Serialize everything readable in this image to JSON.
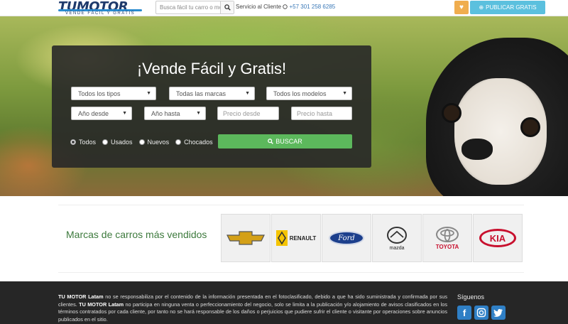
{
  "header": {
    "logo_text": "TUMOTOR",
    "logo_tagline": "VENDE FÁCIL Y GRATIS",
    "search_placeholder": "Busca fácil tu carro o mo",
    "service_label": "Servicio al Cliente",
    "service_phone": "+57 301 258 6285",
    "publish_label": "PUBLICAR GRATIS",
    "icons": {
      "search": "search-icon",
      "whatsapp": "whatsapp-icon",
      "favorite": "heart-icon",
      "publish": "plus-circle-icon"
    }
  },
  "search_panel": {
    "title": "¡Vende Fácil y Gratis!",
    "selects": {
      "type": "Todos los tipos",
      "brand": "Todas las marcas",
      "model": "Todos los modelos",
      "year_from": "Año desde",
      "year_to": "Año hasta"
    },
    "price_from_placeholder": "Precio desde",
    "price_to_placeholder": "Precio hasta",
    "condition_options": [
      "Todos",
      "Usados",
      "Nuevos",
      "Chocados"
    ],
    "selected_condition": "Todos",
    "search_button": "BUSCAR"
  },
  "brands": {
    "title": "Marcas de carros más vendidos",
    "items": [
      {
        "name": "Chevrolet",
        "label": "",
        "color": "#d4a017"
      },
      {
        "name": "Renault",
        "label": "RENAULT",
        "color": "#f5c400"
      },
      {
        "name": "Ford",
        "label": "Ford",
        "color": "#1c3f8c"
      },
      {
        "name": "Mazda",
        "label": "mazda",
        "color": "#1a1a1a"
      },
      {
        "name": "Toyota",
        "label": "TOYOTA",
        "color": "#c8102e"
      },
      {
        "name": "Kia",
        "label": "KIA",
        "color": "#c8102e"
      }
    ]
  },
  "footer": {
    "brand": "TU MOTOR Latam",
    "text_1": "no se responsabiliza por el contenido de la información presentada en el fotoclasificado, debido a que ha sido suministrada y confirmada por sus clientes.",
    "text_2": "no participa en ninguna venta o perfeccionamiento del negocio, solo se limita a la publicación y/o alojamiento de avisos clasificados en los términos contratados por cada cliente, por tanto no se hará responsable de los daños o perjuicios que pudiere sufrir el cliente o visitante por operaciones sobre anuncios publicados en el sitio.",
    "follow_label": "Síguenos",
    "social_icons": [
      "facebook-icon",
      "instagram-icon",
      "twitter-icon"
    ]
  }
}
